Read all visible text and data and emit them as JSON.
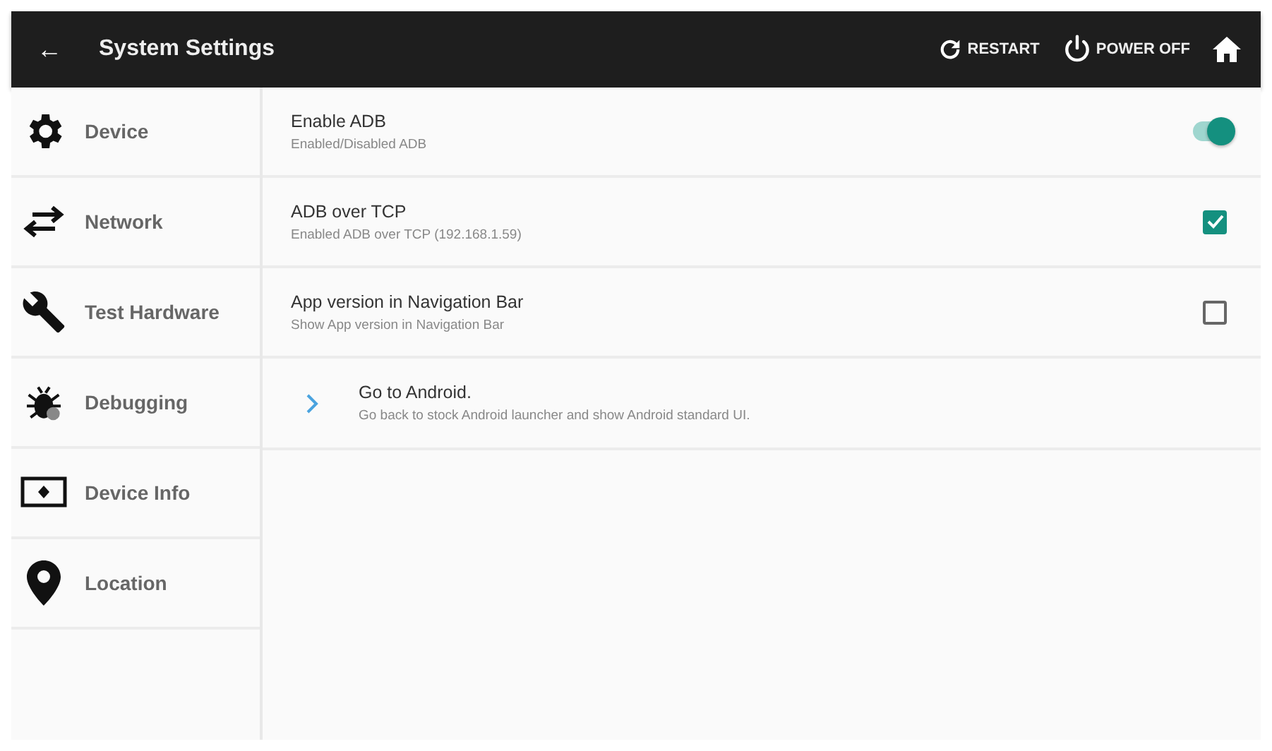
{
  "top_bar": {
    "back": "←",
    "title": "System Settings",
    "actions": [
      {
        "kind": "restart",
        "label": "RESTART"
      },
      {
        "kind": "power",
        "label": "POWER OFF"
      },
      {
        "kind": "home"
      }
    ]
  },
  "sidebar": {
    "items": [
      {
        "kind": "gear",
        "label": "Device"
      },
      {
        "kind": "arrows",
        "label": "Network"
      },
      {
        "kind": "wrench",
        "label": "Test Hardware"
      },
      {
        "kind": "bug",
        "label": "Debugging"
      },
      {
        "kind": "screen",
        "label": "Device Info"
      },
      {
        "kind": "pin",
        "label": "Location"
      }
    ]
  },
  "settings": [
    {
      "kind": "toggle",
      "title": "Enable ADB",
      "subtitle": "Enabled/Disabled ADB",
      "on": true
    },
    {
      "kind": "checkbox",
      "title": "ADB over TCP",
      "subtitle": "Enabled ADB over TCP (192.168.1.59)",
      "checked": true
    },
    {
      "kind": "checkbox",
      "title": "App version in Navigation Bar",
      "subtitle": "Show App version in Navigation Bar",
      "checked": false
    },
    {
      "kind": "link",
      "title": "Go to Android.",
      "subtitle": "Go back to stock Android launcher and show Android standard UI."
    }
  ]
}
